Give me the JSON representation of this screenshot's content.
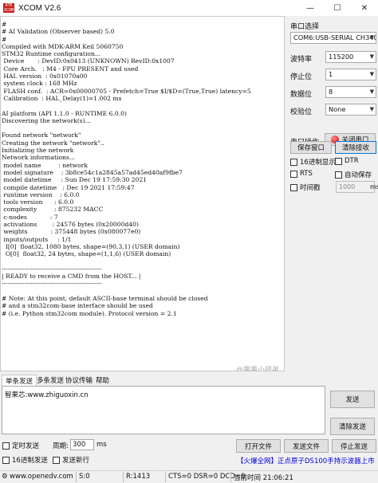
{
  "window": {
    "icon_text": "ATK XCOM",
    "title": "XCOM V2.6",
    "minimize": "—",
    "maximize": "☐",
    "close": "✕"
  },
  "terminal": {
    "lines": [
      "#",
      "# AI Validation (Observer based) 5.0",
      "#",
      "Compiled with MDK-ARM Keil 5060750",
      "STM32 Runtime configuration...",
      " Device       : DevID:0x0413 (UNKNOWN) RevID:0x1007",
      " Core Arch.   : M4 - FPU PRESENT and used",
      " HAL version  : 0x01070a00",
      " system clock : 168 MHz",
      " FLASH conf.  : ACR=0x00000705 - Prefetch=True $I/$D=(True,True) latency=5",
      " Calibration  : HAL_Delay(1)=1.002 ms",
      "",
      "AI platform (API 1.1.0 - RUNTIME 6.0.0)",
      "Discovering the network(s)...",
      "",
      "Found network \"network\"",
      "Creating the network \"network\"..",
      "Initializing the network",
      "Network informations...",
      " model name         : network",
      " model signature    : 3b8ce54c1a2845a57ad45ed40af9fbe7",
      " model datetime     : Sun Dec 19 17:59:30 2021",
      " compile datetime   : Dec 19 2021 17:59:47",
      " runtime version    : 6.0.0",
      " tools version      : 6.0.0",
      " complexity         : 875232 MACC",
      " c-nodes            : 7",
      " activations        : 24576 bytes (0x20000d40)",
      " weights            : 375448 bytes (0x080077e0)",
      " inputs/outputs     : 1/1",
      "  I[0]  float32, 1080 bytes, shape=(90,3,1) (USER domain)",
      "  O[0]  float32, 24 bytes, shape=(1,1,6) (USER domain)",
      "",
      "-------------------------------------------------",
      "| READY to receive a CMD from the HOST... |",
      "-------------------------------------------------",
      "",
      "# Note: At this point, default ASCII-base terminal should be closed",
      "# and a stm32com-base interface should be used",
      "# (i.e. Python stm32com module). Protocol version = 2.1"
    ],
    "watermark": "@果果小师弟"
  },
  "panel": {
    "header": "串口选择",
    "port": "COM6:USB-SERIAL CH340",
    "baud_label": "波特率",
    "baud": "115200",
    "stop_label": "停止位",
    "stop": "1",
    "data_label": "数据位",
    "data": "8",
    "parity_label": "校验位",
    "parity": "None",
    "op_label": "串口操作",
    "close_port": "关闭串口",
    "save_window": "保存窗口",
    "clear_receive": "清除接收",
    "hex_display": "16进制显示",
    "dtr": "DTR",
    "rts": "RTS",
    "auto_save": "自动保存",
    "timestamp": "时间戳",
    "timestamp_ms": "1000",
    "timestamp_unit": "ms"
  },
  "tabs": [
    "单条发送",
    "多条发送",
    "协议传输",
    "帮助"
  ],
  "send": {
    "text": "智果芯:www.zhiguoxin.cn",
    "send_btn": "发送",
    "clear_send": "清除发送"
  },
  "options": {
    "timed_send": "定时发送",
    "period_label": "周期:",
    "period": "300",
    "period_unit": "ms",
    "hex_send": "16进制发送",
    "send_newline": "发送新行",
    "open_file": "打开文件",
    "send_file": "发送文件",
    "stop_send": "停止发送",
    "banner": "【火爆全网】正点原子DS100手持示波器上市"
  },
  "status": {
    "url": "www.openedv.com",
    "sent": "S:0",
    "received": "R:1413",
    "signals": "CTS=0 DSR=0 DCD=0",
    "time": "当前时间 21:06:21"
  }
}
